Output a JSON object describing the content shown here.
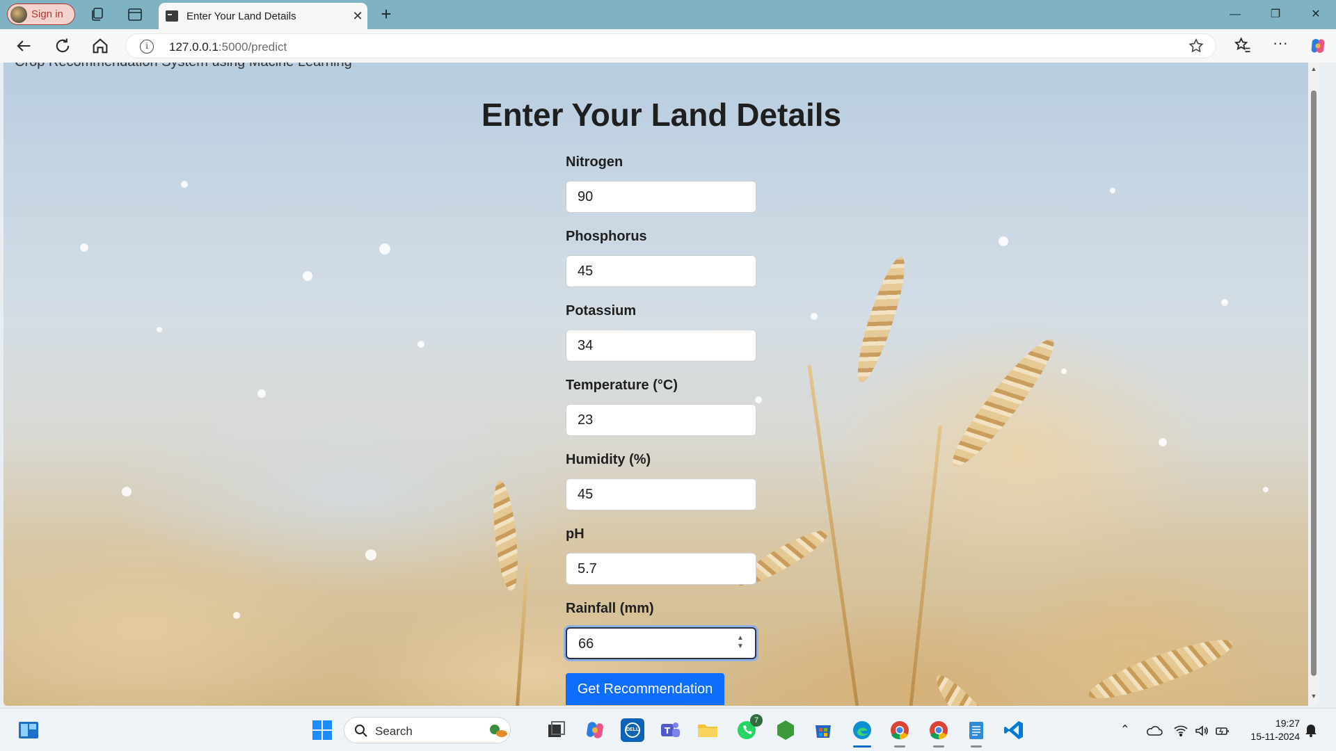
{
  "browser": {
    "signin_label": "Sign in",
    "tab_title": "Enter Your Land Details",
    "url_host": "127.0.0.1",
    "url_rest": ":5000/predict"
  },
  "page": {
    "site_heading": "Crop Recommendation System using Macine Learning",
    "title": "Enter Your Land Details",
    "fields": [
      {
        "label": "Nitrogen",
        "value": "90"
      },
      {
        "label": "Phosphorus",
        "value": "45"
      },
      {
        "label": "Potassium",
        "value": "34"
      },
      {
        "label": "Temperature (°C)",
        "value": "23"
      },
      {
        "label": "Humidity (%)",
        "value": "45"
      },
      {
        "label": "pH",
        "value": "5.7"
      },
      {
        "label": "Rainfall (mm)",
        "value": "66"
      }
    ],
    "submit_label": "Get Recommendation",
    "submit_color": "#0d6efd"
  },
  "taskbar": {
    "search_label": "Search",
    "whatsapp_badge": "7",
    "time": "19:27",
    "date": "15-11-2024"
  }
}
